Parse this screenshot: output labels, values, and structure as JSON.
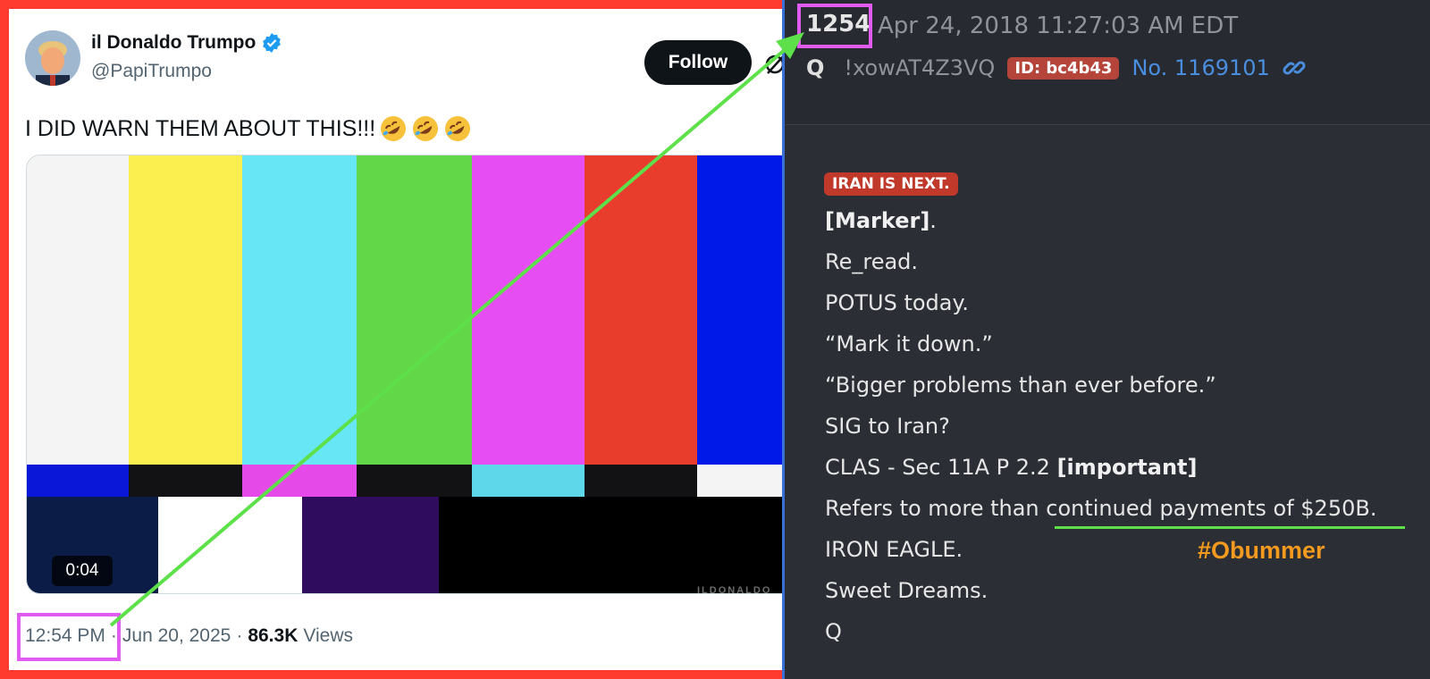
{
  "tweet": {
    "display_name": "il Donaldo Trumpo",
    "handle": "@PapiTrumpo",
    "follow_label": "Follow",
    "text": "I DID WARN THEM ABOUT THIS!!!",
    "emojis": [
      "rolling-on-floor-laughing",
      "rolling-on-floor-laughing",
      "rolling-on-floor-laughing"
    ],
    "video_duration": "0:04",
    "video_watermark": "ILDONALDO",
    "time": "12:54 PM",
    "separator": "·",
    "date": "Jun 20, 2025",
    "views_count": "86.3K",
    "views_label": "Views"
  },
  "q_post": {
    "number": "1254",
    "date": "Apr 24, 2018 11:27:03 AM EDT",
    "name": "Q",
    "tripcode": "!xowAT4Z3VQ",
    "id_label": "ID: bc4b43",
    "post_no": "No. 1169101",
    "tag": "IRAN IS NEXT.",
    "lines": {
      "marker": "[Marker]",
      "marker_suffix": ".",
      "reread": "Re_read.",
      "potus": "POTUS today.",
      "mark": "“Mark it down.”",
      "bigger": "“Bigger problems than ever before.”",
      "sig": "SIG to Iran?",
      "clas": "CLAS - Sec 11A P 2.2 ",
      "important": "[important]",
      "refers": "Refers to more than continued payments of $250B.",
      "iron": "IRON EAGLE.",
      "sweet": "Sweet Dreams.",
      "q": "Q"
    },
    "annotation": "#Obummer"
  },
  "colors": {
    "frame": "#ff3b30",
    "highlight_box": "#e05cf0",
    "arrow": "#5ee04a",
    "annotation": "#f39a1f",
    "q_id_badge": "#b5453b",
    "iran_tag": "#c0392b",
    "link_blue": "#4a8fdf"
  }
}
